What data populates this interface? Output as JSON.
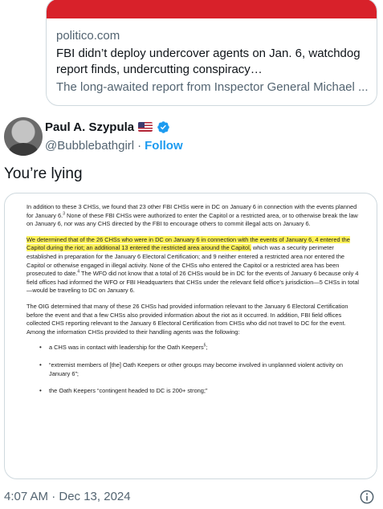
{
  "link_card": {
    "domain": "politico.com",
    "title": "FBI didn’t deploy undercover agents on Jan. 6, watchdog report finds, undercutting conspiracy…",
    "description": "The long-awaited report from Inspector General Michael ...",
    "image_color": "#d8212a"
  },
  "author": {
    "display_name": "Paul A. Szypula",
    "handle": "@Bubblebathgirl",
    "separator": "·",
    "follow_label": "Follow",
    "flag_icon": "us-flag-icon",
    "verified_icon": "verified-badge-icon",
    "verified_color": "#1d9bf0"
  },
  "tweet": {
    "text": "You’re lying"
  },
  "document": {
    "p1": {
      "a": "In addition to these 3 CHSs, we found that 23 other FBI CHSs were in DC on January 6 in connection with the events planned for January 6.",
      "sup": "3",
      "b": "  None of these FBI CHSs were authorized to enter the Capitol or a restricted area, or to otherwise break the law on January 6, nor was any CHS directed by the FBI to encourage others to commit illegal acts on January 6."
    },
    "p2": {
      "highlight": "We determined that of the 26 CHSs who were in DC on January 6 in connection with the events of January 6, 4 entered the Capitol during the riot; an additional 13 entered the restricted area around the Capitol,",
      "a": " which was a security perimeter established in preparation for the January 6 Electoral Certification; and 9 neither entered a restricted area nor entered the Capitol or otherwise engaged in illegal activity.  None of the CHSs who entered the Capitol or a restricted area has been prosecuted to date.",
      "sup": "4",
      "b": "  The WFO did not know that a total of 26 CHSs would be in DC for the events of January 6 because only 4 field offices had informed the WFO or FBI Headquarters that CHSs under the relevant field office’s jurisdiction—5 CHSs in total—would be traveling to DC on January 6."
    },
    "p3": "The OIG determined that many of these 26 CHSs had provided information relevant to the January 6 Electoral Certification before the event and that a few CHSs also provided information about the riot as it occurred.  In addition, FBI field offices collected CHS reporting relevant to the January 6 Electoral Certification from CHSs who did not travel to DC for the event.  Among the information CHSs provided to their handling agents was the following:",
    "bullets": [
      {
        "text": "a CHS was in contact with leadership for the Oath Keepers",
        "sup": "5",
        "tail": ";"
      },
      {
        "text": "“extremist members of [the] Oath Keepers or other groups may become involved in unplanned violent activity on January 6”;",
        "sup": "",
        "tail": ""
      },
      {
        "text": "the Oath Keepers “contingent headed to DC is 200+ strong;”",
        "sup": "",
        "tail": ""
      }
    ],
    "highlight_color": "#fff25a"
  },
  "footer": {
    "timestamp": "4:07 AM · Dec 13, 2024",
    "info_icon": "info-icon"
  }
}
